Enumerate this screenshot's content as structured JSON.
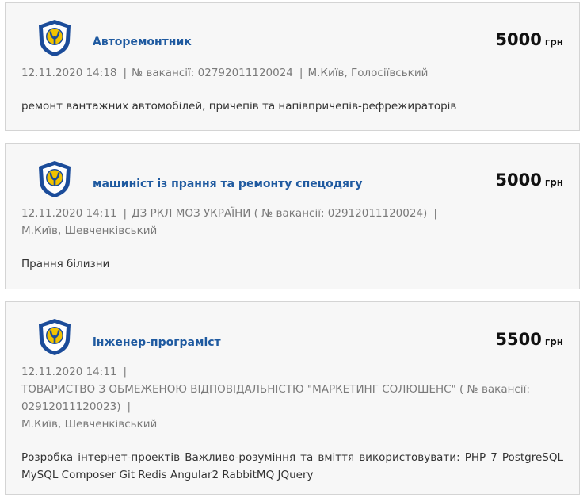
{
  "colors": {
    "title_link": "#1f5aa0",
    "card_background": "#f7f7f7",
    "card_border": "#d4d4d4",
    "meta_text": "#7a7a7a",
    "logo_blue": "#1b4c9a",
    "logo_yellow": "#f2c300"
  },
  "logo_icon": "employment-service-shield-icon",
  "vacancies": [
    {
      "title": "Авторемонтник",
      "salary": "5000",
      "currency": "грн",
      "date": "12.11.2020 14:18",
      "sep1": "|",
      "vacancy_no": "№ вакансії: 02792011120024",
      "sep2": "|",
      "location": "М.Київ, Голосіївський",
      "description": "ремонт вантажних автомобілей, причепів та напівпричепів-рефрежираторів"
    },
    {
      "title": "машиніст із прання та ремонту спецодягу",
      "salary": "5000",
      "currency": "грн",
      "date": "12.11.2020 14:11",
      "sep1": "|",
      "employer_with_no": "ДЗ РКЛ МОЗ УКРАЇНИ ( № вакансії: 02912011120024)",
      "sep2": "|",
      "location": "М.Київ, Шевченківський",
      "description": "Прання білизни"
    },
    {
      "title": "інженер-програміст",
      "salary": "5500",
      "currency": "грн",
      "date": "12.11.2020 14:11",
      "sep1": "|",
      "employer_with_no": "ТОВАРИСТВО З ОБМЕЖЕНОЮ ВІДПОВІДАЛЬНІСТЮ \"МАРКЕТИНГ СОЛЮШЕНС\" ( № вакансії: 02912011120023)",
      "sep2": "|",
      "location": "М.Київ, Шевченківський",
      "description": "Розробка інтернет-проектів Важливо-розуміння та вміття використовувати: PHP 7 PostgreSQL MySQL Composer Git Redis Angular2 RabbitMQ JQuery"
    }
  ]
}
